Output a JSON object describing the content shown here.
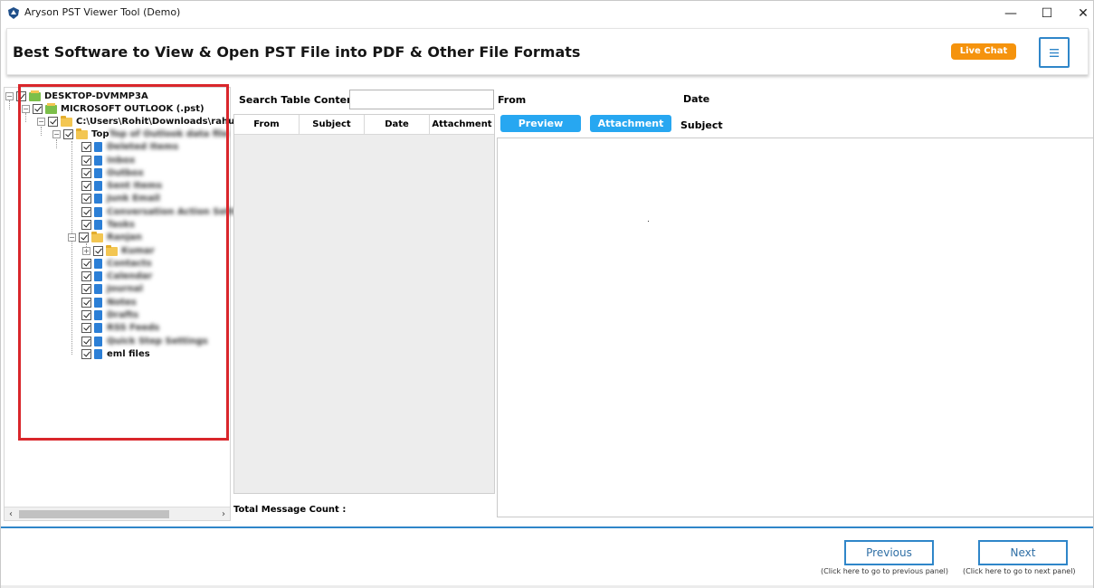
{
  "window": {
    "title": "Aryson PST Viewer Tool (Demo)",
    "minimize": "—",
    "maximize": "☐",
    "close": "✕"
  },
  "banner": {
    "title": "Best Software to View & Open PST File into PDF & Other File Formats",
    "live_chat": "Live Chat",
    "menu_icon": "hamburger-icon"
  },
  "tree": {
    "root": "DESKTOP-DVMMP3A",
    "outlook": "MICROSOFT OUTLOOK (.pst)",
    "path": "C:\\Users\\Rohit\\Downloads\\rahu",
    "top_folder": "Top of Outlook data file",
    "folders": [
      "Deleted Items",
      "Inbox",
      "Outbox",
      "Sent Items",
      "Junk Email",
      "Conversation Action Settings",
      "Tasks"
    ],
    "subfolder_parent": "Ranjan",
    "subfolder_child": "Kumar",
    "folders_after": [
      "Contacts",
      "Calendar",
      "Journal",
      "Notes",
      "Drafts",
      "RSS Feeds",
      "Quick Step Settings"
    ],
    "last_item": "eml files"
  },
  "search": {
    "label": "Search Table Contents:",
    "value": ""
  },
  "message_table": {
    "columns": [
      "From",
      "Subject",
      "Date",
      "Attachment"
    ],
    "rows": []
  },
  "total_count_label": "Total Message Count :",
  "preview": {
    "from_label": "From",
    "date_label": "Date",
    "subject_label": "Subject",
    "tab_preview": "Preview",
    "tab_attachment": "Attachment"
  },
  "navigation": {
    "previous": "Previous",
    "previous_hint": "(Click here to go to previous panel)",
    "next": "Next",
    "next_hint": "(Click here to go to next panel)"
  },
  "colors": {
    "accent_blue": "#2f86c9",
    "tab_blue": "#27a7f1",
    "live_chat_orange": "#f5930d",
    "highlight_red": "#d9262b"
  }
}
